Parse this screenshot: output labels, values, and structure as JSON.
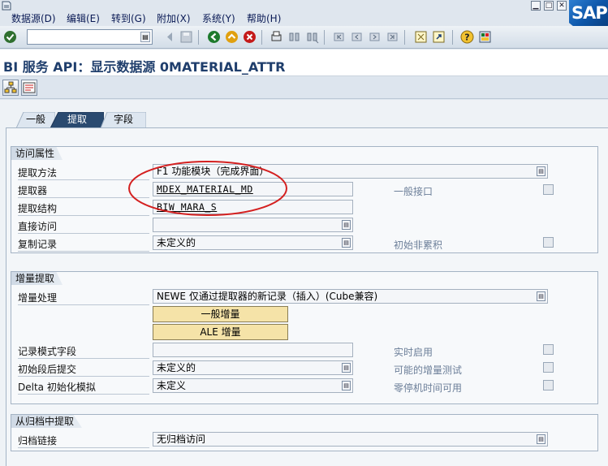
{
  "menubar": {
    "items": [
      "数据源(D)",
      "编辑(E)",
      "转到(G)",
      "附加(X)",
      "系统(Y)",
      "帮助(H)"
    ],
    "logo": "SAP"
  },
  "toolbar": {
    "command_field": "",
    "icons": [
      "check-icon",
      "back-icon",
      "exit-icon",
      "cancel-icon",
      "print-icon",
      "find-icon",
      "find-next-icon",
      "first-page-icon",
      "prev-page-icon",
      "next-page-icon",
      "last-page-icon",
      "new-session-icon",
      "shortcut-icon",
      "help-icon",
      "layout-icon"
    ]
  },
  "title": "BI 服务 API：显示数据源 0MATERIAL_ATTR",
  "tabs": [
    "一般",
    "提取",
    "字段"
  ],
  "active_tab": "提取",
  "access": {
    "title": "访问属性",
    "rows": [
      {
        "label": "提取方法",
        "value": "F1 功能模块（完成界面）"
      },
      {
        "label": "提取器",
        "value": "MDEX_MATERIAL_MD"
      },
      {
        "label": "提取结构",
        "value": "BIW_MARA_S"
      },
      {
        "label": "直接访问",
        "value": ""
      },
      {
        "label": "复制记录",
        "value": "未定义的"
      }
    ],
    "right_labels": [
      "一般接口",
      "初始非累积"
    ]
  },
  "delta": {
    "title": "增量提取",
    "process_label": "增量处理",
    "process_value": "NEWE 仅通过提取器的新记录（插入）(Cube兼容)",
    "btn_general": "一般增量",
    "btn_ale": "ALE 增量",
    "rows": [
      {
        "label": "记录模式字段",
        "value": ""
      },
      {
        "label": "初始段后提交",
        "value": "未定义的"
      },
      {
        "label": "Delta 初始化模拟",
        "value": "未定义"
      }
    ],
    "right_labels": [
      "实时启用",
      "可能的增量测试",
      "零停机时间可用"
    ]
  },
  "archive": {
    "title": "从归档中提取",
    "label": "归档链接",
    "value": "无归档访问"
  },
  "colors": {
    "title": "#1f3e6c",
    "annotation": "#d42020",
    "push_button": "#f5e3a8",
    "active_tab": "#2a4a70"
  }
}
